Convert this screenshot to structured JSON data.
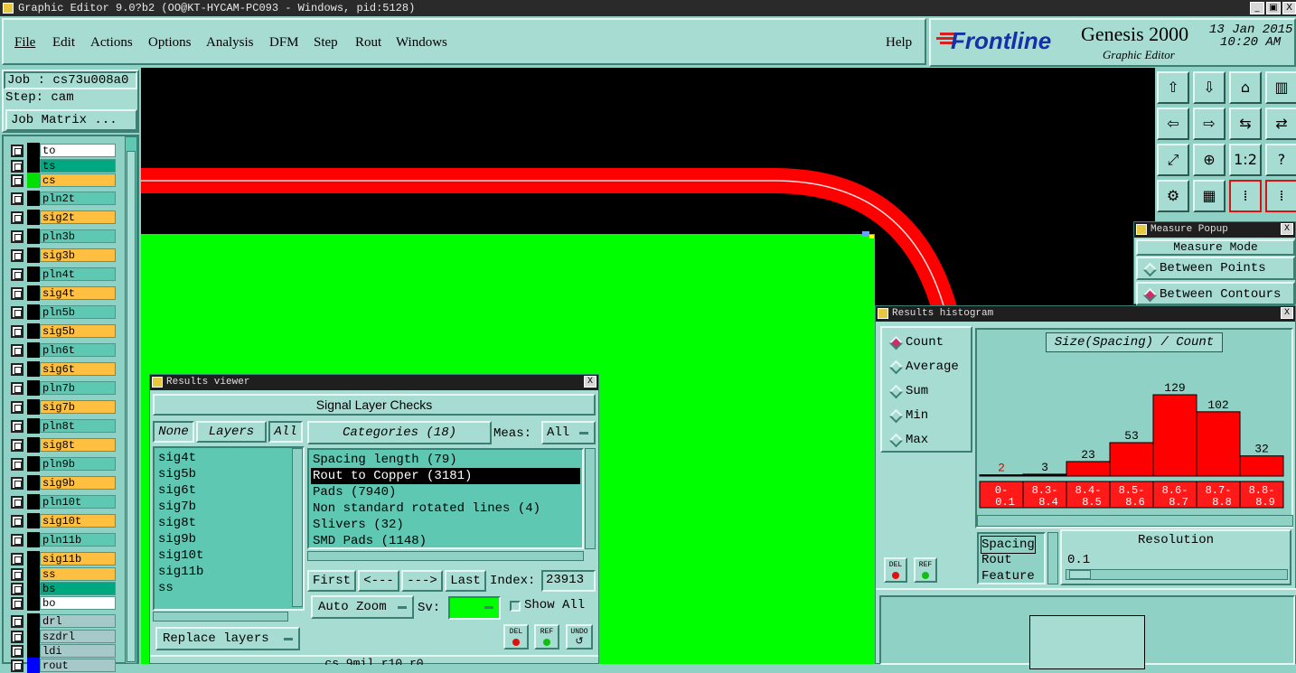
{
  "window": {
    "title": "Graphic Editor 9.0?b2 (OO@KT-HYCAM-PC093 - Windows, pid:5128)",
    "minimize": "_",
    "restore": "▣",
    "close": "X"
  },
  "menu": [
    "File",
    "Edit",
    "Actions",
    "Options",
    "Analysis",
    "DFM",
    "Step",
    "Rout",
    "Windows"
  ],
  "help": "Help",
  "brand": {
    "logo": "Frontline",
    "product": "Genesis 2000",
    "subtitle": "Graphic Editor",
    "date": "13 Jan 2015",
    "time": "10:20 AM"
  },
  "job": {
    "job_label": "Job : cs73u008a0",
    "step_label": "Step: cam",
    "matrix_button": "Job Matrix ..."
  },
  "layers": [
    {
      "name": "to",
      "color": "#ffffff",
      "marker": "#000000"
    },
    {
      "name": "ts",
      "color": "#00a882",
      "marker": "#000000"
    },
    {
      "name": "cs",
      "color": "#ffbf40",
      "marker": "#00e000"
    },
    {
      "name": "pln2t",
      "color": "#5fc8b3",
      "marker": "#000000"
    },
    {
      "name": "sig2t",
      "color": "#ffbf40",
      "marker": "#000000"
    },
    {
      "name": "pln3b",
      "color": "#5fc8b3",
      "marker": "#000000"
    },
    {
      "name": "sig3b",
      "color": "#ffbf40",
      "marker": "#000000"
    },
    {
      "name": "pln4t",
      "color": "#5fc8b3",
      "marker": "#000000"
    },
    {
      "name": "sig4t",
      "color": "#ffbf40",
      "marker": "#000000"
    },
    {
      "name": "pln5b",
      "color": "#5fc8b3",
      "marker": "#000000"
    },
    {
      "name": "sig5b",
      "color": "#ffbf40",
      "marker": "#000000"
    },
    {
      "name": "pln6t",
      "color": "#5fc8b3",
      "marker": "#000000"
    },
    {
      "name": "sig6t",
      "color": "#ffbf40",
      "marker": "#000000"
    },
    {
      "name": "pln7b",
      "color": "#5fc8b3",
      "marker": "#000000"
    },
    {
      "name": "sig7b",
      "color": "#ffbf40",
      "marker": "#000000"
    },
    {
      "name": "pln8t",
      "color": "#5fc8b3",
      "marker": "#000000"
    },
    {
      "name": "sig8t",
      "color": "#ffbf40",
      "marker": "#000000"
    },
    {
      "name": "pln9b",
      "color": "#5fc8b3",
      "marker": "#000000"
    },
    {
      "name": "sig9b",
      "color": "#ffbf40",
      "marker": "#000000"
    },
    {
      "name": "pln10t",
      "color": "#5fc8b3",
      "marker": "#000000"
    },
    {
      "name": "sig10t",
      "color": "#ffbf40",
      "marker": "#000000"
    },
    {
      "name": "pln11b",
      "color": "#5fc8b3",
      "marker": "#000000"
    },
    {
      "name": "sig11b",
      "color": "#ffbf40",
      "marker": "#000000"
    },
    {
      "name": "ss",
      "color": "#ffbf40",
      "marker": "#000000"
    },
    {
      "name": "bs",
      "color": "#00a882",
      "marker": "#000000"
    },
    {
      "name": "bo",
      "color": "#ffffff",
      "marker": "#000000"
    },
    {
      "name": "drl",
      "color": "#a7c8c8",
      "marker": "#000000"
    },
    {
      "name": "szdrl",
      "color": "#a7c8c8",
      "marker": "#000000"
    },
    {
      "name": "ldi",
      "color": "#a7c8c8",
      "marker": "#000000"
    },
    {
      "name": "rout",
      "color": "#a7c8c8",
      "marker": "#0000ff"
    }
  ],
  "toolbar_icons": [
    "top-icon",
    "bottom-icon",
    "home-icon",
    "panel-icon",
    "left-icon",
    "right-icon",
    "mirror-icon",
    "swap-icon",
    "fit-icon",
    "center-icon",
    "scale-1-2-label",
    "help-icon",
    "tools-icon",
    "grid-icon",
    "layers-icon",
    "layers-active-icon"
  ],
  "toolbar_text": {
    "scale": "1:2",
    "help": "?"
  },
  "measure": {
    "title": "Measure Popup",
    "mode": "Measure Mode",
    "options": [
      "Between Points",
      "Between Contours"
    ],
    "selected": "Between Contours",
    "close": "X"
  },
  "results_viewer": {
    "title": "Results viewer",
    "heading": "Signal Layer Checks",
    "none_btn": "None",
    "layers_btn": "Layers",
    "all_btn": "All",
    "categories_btn": "Categories (18)",
    "meas_label": "Meas:",
    "meas_value": "All",
    "layers": [
      "sig4t",
      "sig5b",
      "sig6t",
      "sig7b",
      "sig8t",
      "sig9b",
      "sig10t",
      "sig11b",
      "ss"
    ],
    "categories": [
      "Spacing length (79)",
      "Rout to Copper (3181)",
      "Pads (7940)",
      "Non standard rotated lines (4)",
      "Slivers (32)",
      "SMD Pads (1148)"
    ],
    "selected_category": "Rout to Copper (3181)",
    "first": "First",
    "prev": "<---",
    "next": "--->",
    "last": "Last",
    "index_label": "Index:",
    "index_value": "23913",
    "auto_zoom": "Auto Zoom",
    "sv_label": "Sv:",
    "show_all": "Show All",
    "replace_layers": "Replace layers",
    "del": "DEL",
    "ref": "REF",
    "undo": "UNDO",
    "footer": "cs 9mil r10 r0",
    "close": "X"
  },
  "histogram": {
    "title": "Results histogram",
    "modes": [
      "Count",
      "Average",
      "Sum",
      "Min",
      "Max"
    ],
    "selected_mode": "Count",
    "chart_title": "Size(Spacing) / Count",
    "resolution_label": "Resolution",
    "resolution_value": "0.1",
    "type_list": [
      "Spacing",
      "Rout",
      "Feature"
    ],
    "del": "DEL",
    "ref": "REF",
    "close": "X"
  },
  "chart_data": {
    "type": "bar",
    "title": "Size(Spacing) / Count",
    "categories": [
      "0-\n0.1",
      "8.3-\n8.4",
      "8.4-\n8.5",
      "8.5-\n8.6",
      "8.6-\n8.7",
      "8.7-\n8.8",
      "8.8-\n8.9"
    ],
    "values": [
      2,
      3,
      23,
      53,
      129,
      102,
      32
    ],
    "xlabel": "",
    "ylabel": "",
    "ylim": [
      0,
      129
    ]
  }
}
